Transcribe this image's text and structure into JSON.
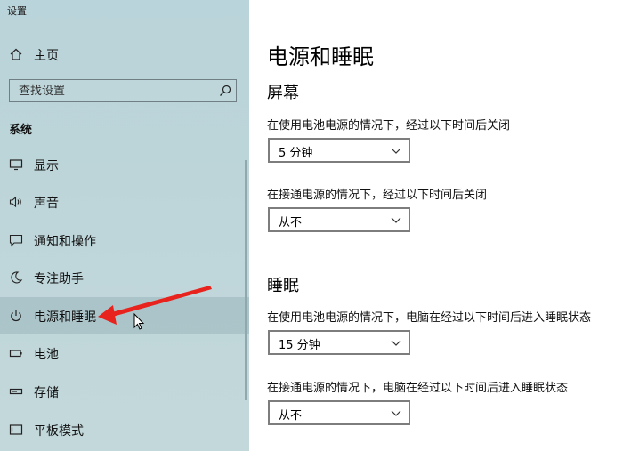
{
  "window": {
    "title": "设置"
  },
  "sidebar": {
    "home_label": "主页",
    "search": {
      "placeholder": "查找设置"
    },
    "section_label": "系统",
    "items": [
      {
        "label": "显示",
        "icon": "monitor-icon"
      },
      {
        "label": "声音",
        "icon": "speaker-icon"
      },
      {
        "label": "通知和操作",
        "icon": "message-icon"
      },
      {
        "label": "专注助手",
        "icon": "moon-icon"
      },
      {
        "label": "电源和睡眠",
        "icon": "power-icon",
        "selected": true
      },
      {
        "label": "电池",
        "icon": "battery-icon"
      },
      {
        "label": "存储",
        "icon": "storage-icon"
      },
      {
        "label": "平板模式",
        "icon": "tablet-icon"
      }
    ]
  },
  "main": {
    "title": "电源和睡眠",
    "screen": {
      "title": "屏幕",
      "battery_label": "在使用电池电源的情况下，经过以下时间后关闭",
      "battery_value": "5 分钟",
      "plugged_label": "在接通电源的情况下，经过以下时间后关闭",
      "plugged_value": "从不"
    },
    "sleep": {
      "title": "睡眠",
      "battery_label": "在使用电池电源的情况下，电脑在经过以下时间后进入睡眠状态",
      "battery_value": "15 分钟",
      "plugged_label": "在接通电源的情况下，电脑在经过以下时间后进入睡眠状态",
      "plugged_value": "从不"
    }
  },
  "colors": {
    "sidebar_bg": "#bdd5d9",
    "annotation_arrow": "#e8231e"
  }
}
